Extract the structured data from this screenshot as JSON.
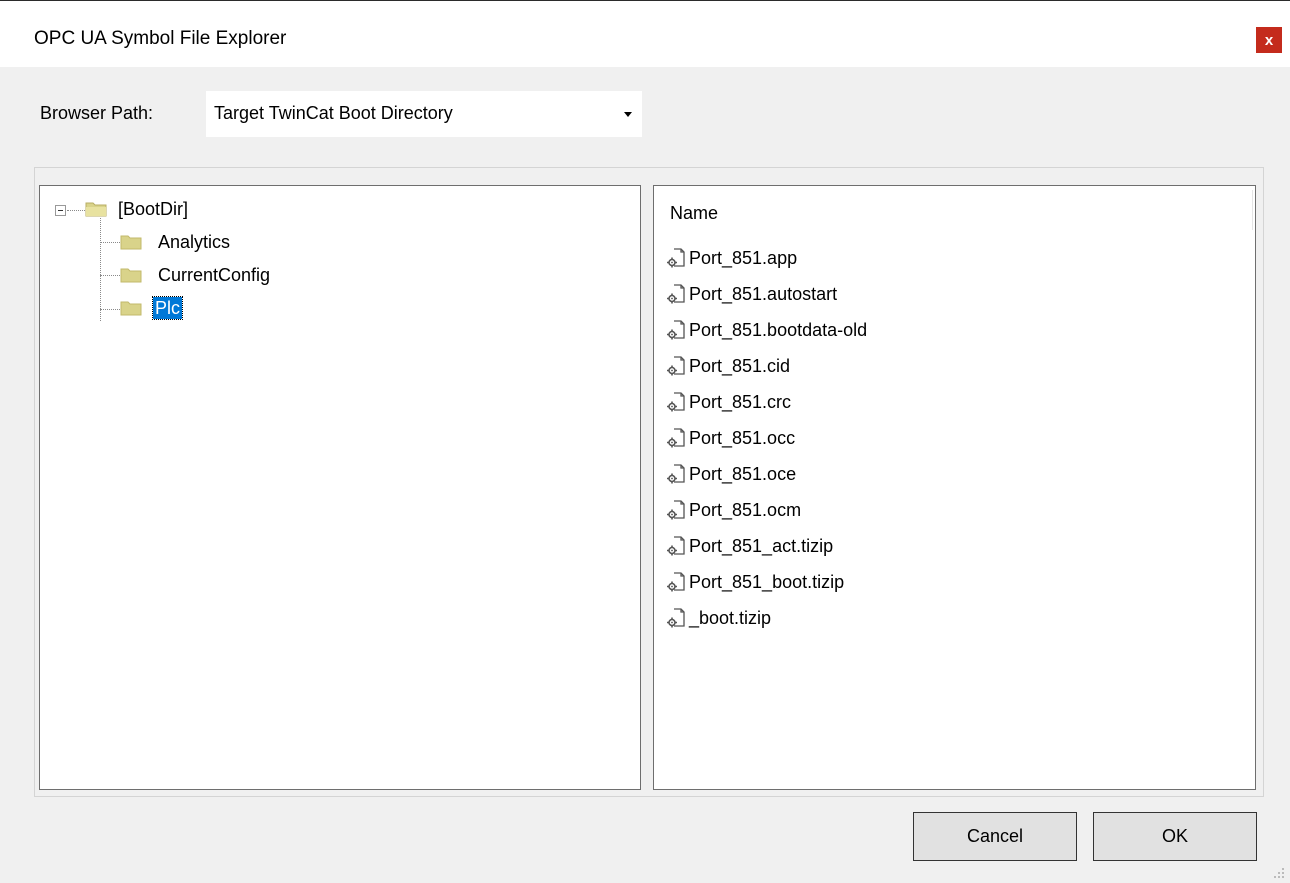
{
  "window": {
    "title": "OPC UA Symbol File Explorer",
    "close_glyph": "x"
  },
  "browser_path": {
    "label": "Browser Path:",
    "selected": "Target TwinCat Boot Directory"
  },
  "tree": {
    "root": {
      "label": "[BootDir]",
      "expanded": true,
      "icon": "folder-open-icon"
    },
    "children": [
      {
        "label": "Analytics",
        "selected": false,
        "icon": "folder-icon"
      },
      {
        "label": "CurrentConfig",
        "selected": false,
        "icon": "folder-icon"
      },
      {
        "label": "Plc",
        "selected": true,
        "icon": "folder-icon"
      }
    ]
  },
  "file_list": {
    "column_header": "Name",
    "items": [
      "Port_851.app",
      "Port_851.autostart",
      "Port_851.bootdata-old",
      "Port_851.cid",
      "Port_851.crc",
      "Port_851.occ",
      "Port_851.oce",
      "Port_851.ocm",
      "Port_851_act.tizip",
      "Port_851_boot.tizip",
      "_boot.tizip"
    ],
    "item_icon": "settings-file-icon"
  },
  "buttons": {
    "cancel": "Cancel",
    "ok": "OK"
  },
  "colors": {
    "close": "#c42b1c",
    "selection": "#0078d7",
    "folder": "#d9d38a"
  }
}
